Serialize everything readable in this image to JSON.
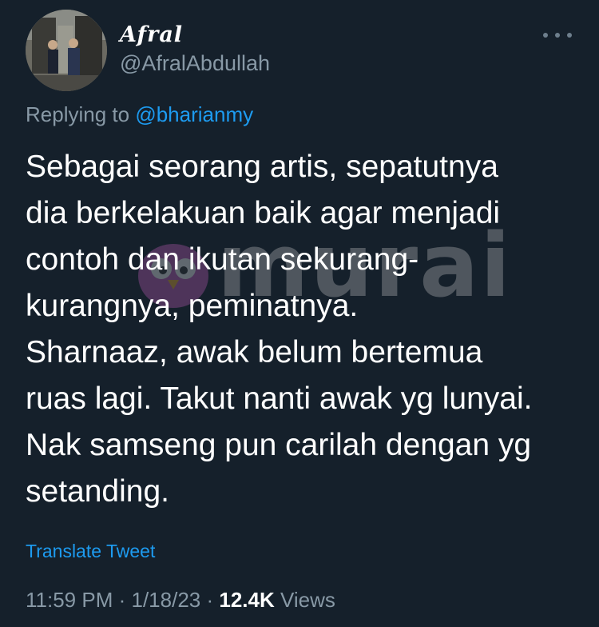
{
  "author": {
    "display_name": "Afral",
    "handle": "@AfralAbdullah"
  },
  "reply": {
    "prefix": "Replying to",
    "mention": "@bharianmy"
  },
  "tweet": {
    "text": "Sebagai seorang artis, sepatutnya\ndia berkelakuan baik agar menjadi\ncontoh dan ikutan sekurang-\nkurangnya, peminatnya.\nSharnaaz, awak belum bertemua\nruas lagi. Takut nanti awak yg lunyai.\nNak samseng pun carilah dengan yg\nsetanding."
  },
  "watermark": {
    "text": "murai"
  },
  "actions": {
    "translate_label": "Translate Tweet"
  },
  "meta": {
    "time": "11:59 PM",
    "separator": "·",
    "date": "1/18/23",
    "views_count": "12.4K",
    "views_label": "Views"
  },
  "colors": {
    "background": "#15202b",
    "accent": "#1d9bf0",
    "secondary_text": "#8899a6"
  }
}
